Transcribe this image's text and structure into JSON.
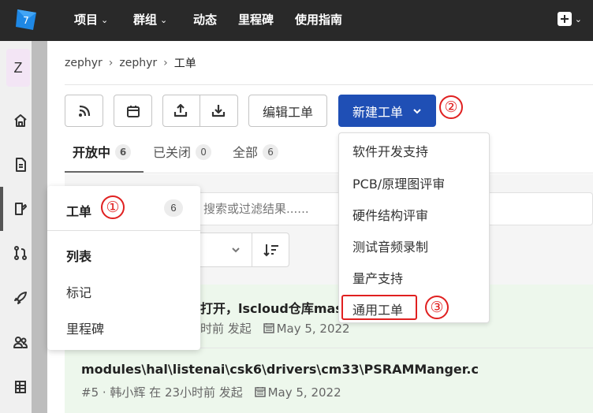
{
  "nav": {
    "items": [
      {
        "label": "项目",
        "has_chevron": true
      },
      {
        "label": "群组",
        "has_chevron": true
      },
      {
        "label": "动态",
        "has_chevron": false
      },
      {
        "label": "里程碑",
        "has_chevron": false
      },
      {
        "label": "使用指南",
        "has_chevron": false
      }
    ]
  },
  "sidebar": {
    "project_initial": "Z"
  },
  "breadcrumb": {
    "group": "zephyr",
    "project": "zephyr",
    "current": "工单"
  },
  "toolbar": {
    "edit_label": "编辑工单",
    "new_label": "新建工单"
  },
  "tabs": [
    {
      "label": "开放中",
      "count": "6"
    },
    {
      "label": "已关闭",
      "count": "0"
    },
    {
      "label": "全部",
      "count": "6"
    }
  ],
  "search": {
    "placeholder": "搜索或过滤结果......"
  },
  "flyout": {
    "title": "工单",
    "count": "6",
    "items": [
      "列表",
      "标记",
      "里程碑"
    ]
  },
  "dropdown": {
    "items": [
      "软件开发支持",
      "PCB/原理图评审",
      "硬件结构评审",
      "测试音频录制",
      "量产支持",
      "通用工单"
    ]
  },
  "issues": [
    {
      "title": "打开，lscloud仓库mas",
      "meta_prefix": "时前 发起",
      "date": "May 5, 2022"
    },
    {
      "title": "modules\\hal\\listenai\\csk6\\drivers\\cm33\\PSRAMManger.c",
      "meta_prefix": "#5 · 韩小辉 在 23小时前 发起",
      "date": "May 5, 2022"
    }
  ],
  "markers": [
    "①",
    "②",
    "③"
  ],
  "colors": {
    "navbar": "#292929",
    "primary": "#1f4fb5",
    "annotation": "#e02020",
    "row_highlight": "#edf7ec"
  }
}
